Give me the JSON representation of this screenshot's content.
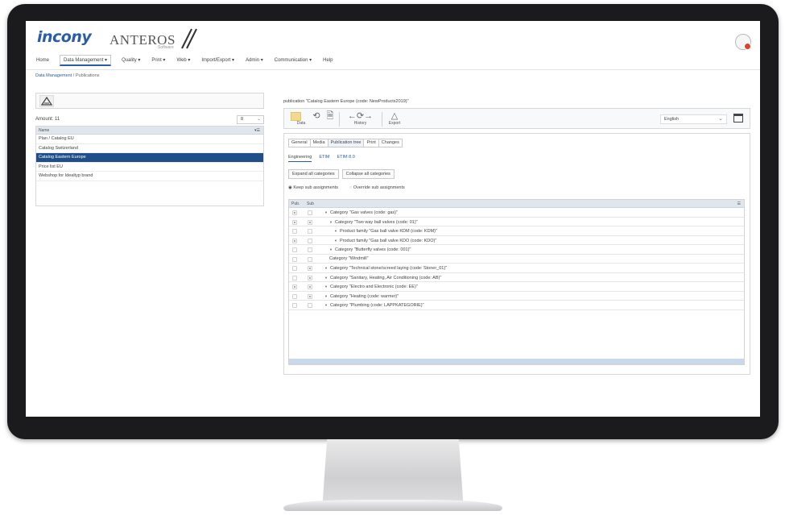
{
  "header": {
    "logo_text": "incony",
    "brand_text": "ANTEROS",
    "brand_sub": "Software"
  },
  "menu": [
    {
      "label": "Home"
    },
    {
      "label": "Data Management ▾",
      "active": true
    },
    {
      "label": "Quality ▾"
    },
    {
      "label": "Print ▾"
    },
    {
      "label": "Web ▾"
    },
    {
      "label": "Import/Export ▾"
    },
    {
      "label": "Admin ▾"
    },
    {
      "label": "Communication ▾"
    },
    {
      "label": "Help"
    }
  ],
  "breadcrumb": {
    "link": "Data Management",
    "sep": " / ",
    "current": "Publications"
  },
  "left": {
    "amount": "Amount: 11",
    "page_size": "8",
    "list_header": "Name",
    "rows": [
      {
        "label": "Plan / Catalog EU",
        "selected": false
      },
      {
        "label": "Catalog Switzerland",
        "selected": false
      },
      {
        "label": "Catalog Eastern Europe",
        "selected": true
      },
      {
        "label": "Price list EU",
        "selected": false
      },
      {
        "label": "Webshop for Idealtyp brand",
        "selected": false
      }
    ]
  },
  "right": {
    "title": "publication \"Catalog Eastern Europe (code: NewProducts2019)\"",
    "toolbar": {
      "data_label": "Data",
      "history_label": "History",
      "export_label": "Export",
      "language": "English"
    },
    "tabs": [
      {
        "label": "General",
        "active": false
      },
      {
        "label": "Media",
        "active": false
      },
      {
        "label": "Publication tree",
        "active": true
      },
      {
        "label": "Print",
        "active": false
      },
      {
        "label": "Changes",
        "active": false
      }
    ],
    "subtabs": [
      {
        "label": "Engineering",
        "active": true
      },
      {
        "label": "ETIM",
        "active": false
      },
      {
        "label": "ETIM 8.0",
        "active": false
      }
    ],
    "expand_label": "Expand all categories",
    "collapse_label": "Collapse all categories",
    "keep_label": "Keep sub assignments",
    "override_label": "Override sub assignments",
    "grid_col1": "Pub.",
    "grid_col2": "Sub",
    "grid_rows": [
      {
        "text": "Category \"Gas valves (code: gas)\"",
        "level": 0,
        "arrow": true,
        "c1": true,
        "c2": false
      },
      {
        "text": "Category \"Two way ball valves (code: 01)\"",
        "level": 1,
        "arrow": true,
        "c1": true,
        "c2": true
      },
      {
        "text": "Product family \"Gas ball valve KDM (code: KDM)\"",
        "level": 2,
        "arrow": true,
        "c1": false,
        "c2": false
      },
      {
        "text": "Product family \"Gas ball valve KDO (code: KDO)\"",
        "level": 2,
        "arrow": true,
        "c1": true,
        "c2": false
      },
      {
        "text": "Category \"Butterfly valves (code: 001)\"",
        "level": 1,
        "arrow": true,
        "c1": false,
        "c2": false
      },
      {
        "text": "Category \"Windmill\"",
        "level": 1,
        "arrow": false,
        "c1": false,
        "c2": false
      },
      {
        "text": "Category \"Technical stone/screed laying (code: Stoner_01)\"",
        "level": 0,
        "arrow": true,
        "c1": false,
        "c2": true
      },
      {
        "text": "Category \"Sanitary, Heating, Air Conditioning (code: AB)\"",
        "level": 0,
        "arrow": true,
        "c1": false,
        "c2": true
      },
      {
        "text": "Category \"Electro and Electronic (code: EE)\"",
        "level": 0,
        "arrow": true,
        "c1": true,
        "c2": true
      },
      {
        "text": "Category \"Heating (code: warmer)\"",
        "level": 0,
        "arrow": true,
        "c1": false,
        "c2": true
      },
      {
        "text": "Category \"Plumbing (code: LAPPKATEGORIE)\"",
        "level": 0,
        "arrow": true,
        "c1": false,
        "c2": false
      }
    ]
  }
}
